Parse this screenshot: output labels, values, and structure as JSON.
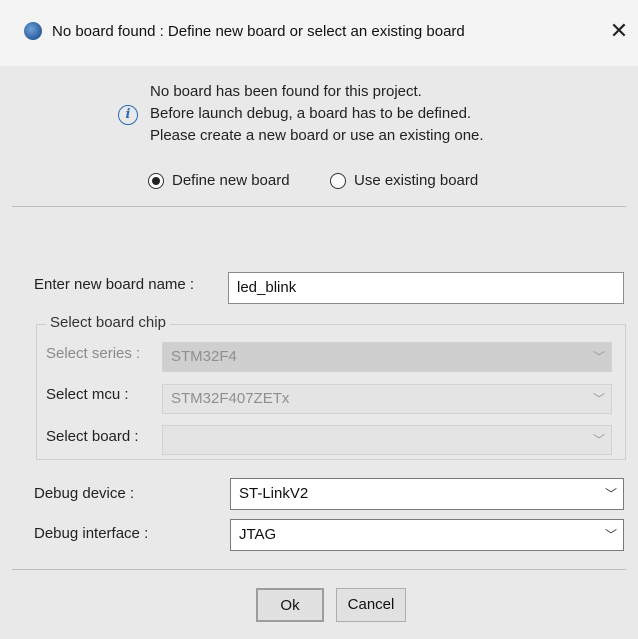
{
  "window": {
    "title": "No board found : Define new board or select an existing board",
    "close_glyph": "✕",
    "icon": "app-icon"
  },
  "message": {
    "icon": "info-icon",
    "icon_glyph": "i",
    "line1": "No board has been found for this project.",
    "line2": "Before launch debug, a board has to be defined.",
    "line3": "Please create a new board or use an existing one."
  },
  "mode": {
    "define_new_label": "Define new board",
    "use_existing_label": "Use existing board",
    "selected": "define_new"
  },
  "board_name": {
    "label": "Enter new board name :",
    "value": "led_blink"
  },
  "chip_group": {
    "title": "Select board chip",
    "series_label": "Select series :",
    "series_value": "STM32F4",
    "mcu_label": "Select mcu :",
    "mcu_value": "STM32F407ZETx",
    "board_label": "Select board :",
    "board_value": ""
  },
  "debug": {
    "device_label": "Debug device :",
    "device_value": "ST-LinkV2",
    "interface_label": "Debug interface :",
    "interface_value": "JTAG"
  },
  "buttons": {
    "ok": "Ok",
    "cancel": "Cancel"
  },
  "chevron_glyph": "﹀"
}
